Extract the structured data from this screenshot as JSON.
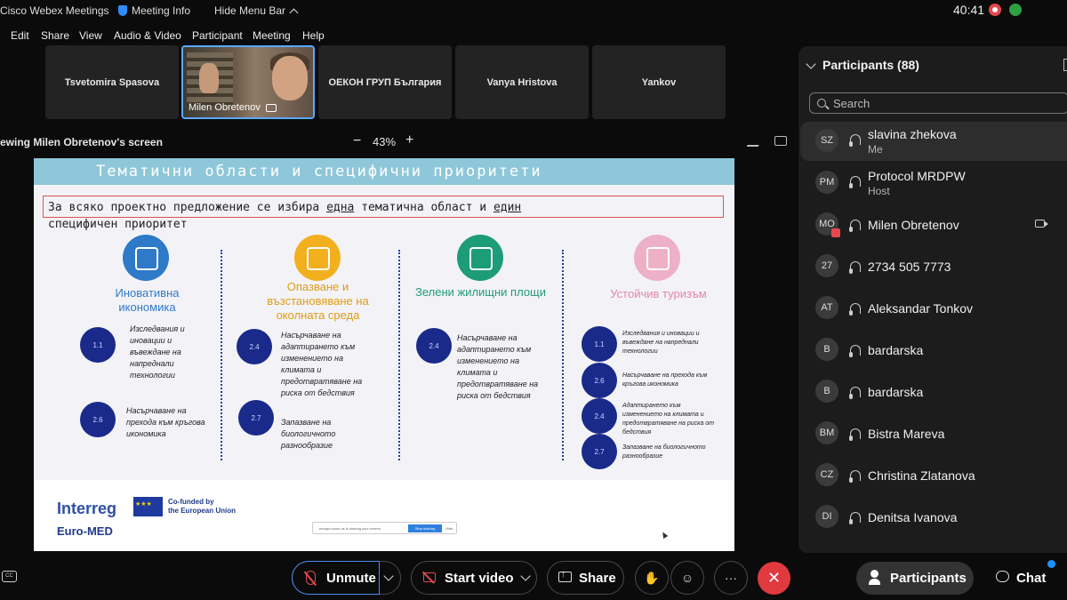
{
  "titlebar": {
    "app_name": "Cisco Webex Meetings",
    "meeting_info": "Meeting Info",
    "hide_menu": "Hide Menu Bar",
    "clock": "40:41"
  },
  "menu": [
    "Edit",
    "Share",
    "View",
    "Audio & Video",
    "Participant",
    "Meeting",
    "Help"
  ],
  "thumbnails": [
    {
      "name": "Tsvetomira Spasova"
    },
    {
      "name": "Milen Obretenov",
      "active": true
    },
    {
      "name": "ОЕКОН ГРУП България"
    },
    {
      "name": "Vanya Hristova"
    },
    {
      "name": "Yankov"
    }
  ],
  "viewbar": {
    "label": "ewing Milen Obretenov's screen",
    "minus": "−",
    "zoom": "43%",
    "plus": "+"
  },
  "slide": {
    "title": "Тематични области и специфични приоритети",
    "intro_a": "За всяко проектно предложение се избира ",
    "intro_u1": "една",
    "intro_b": " тематична област и ",
    "intro_u2": "един",
    "intro_c": "специфичен приоритет",
    "columns": [
      {
        "title": "Иновативна икономика",
        "color": "#2f79c9",
        "title_color": "#2f79c9"
      },
      {
        "title": "Опазване и възстановяване на околната среда",
        "color": "#f2b01e",
        "title_color": "#e09c12"
      },
      {
        "title": "Зелени жилищни площи",
        "color": "#1d9c7a",
        "title_color": "#1d9c7a"
      },
      {
        "title": "Устойчив туризъм",
        "color": "#eeb0c6",
        "title_color": "#e485a6"
      }
    ],
    "items": [
      {
        "num": "1.1",
        "text": "Изследвания и иновации и въвеждане на напреднали технологии"
      },
      {
        "num": "2.6",
        "text": "Насърчаване на прехода към кръгова икономика"
      },
      {
        "num": "2.4",
        "text": "Насърчаване на адаптирането към изменението на климата и предотвратяване на риска от бедствия"
      },
      {
        "num": "2.7",
        "text": "Запазване на биологичното разнообразие"
      },
      {
        "num": "2.4",
        "text": "Насърчаване на адаптирането към изменението на климата и предотвратяване на риска от бедствия"
      },
      {
        "num": "1.1",
        "text": "Изследвания и иновации и въвеждане на напреднали технологии"
      },
      {
        "num": "2.6",
        "text": "Насърчаване на прехода към кръгова икономика"
      },
      {
        "num": "2.4",
        "text": "Адаптирането към изменението на климата и предотвратяване на риска от бедствия"
      },
      {
        "num": "2.7",
        "text": "Запазване на биологичното разнообразие"
      }
    ],
    "footer": {
      "interreg": "Interreg",
      "euro_med": "Euro-MED",
      "cofund_1": "Co-funded by",
      "cofund_2": "the European Union",
      "share_text": "europa.zoom.us is sharing your screen.",
      "share_btn": "Stop sharing",
      "share_hide": "Hide"
    }
  },
  "participants": {
    "header": "Participants (88)",
    "search_placeholder": "Search",
    "list": [
      {
        "initials": "SZ",
        "name": "slavina zhekova",
        "role": "Me"
      },
      {
        "initials": "PM",
        "name": "Protocol MRDPW",
        "role": "Host"
      },
      {
        "initials": "MO",
        "name": "Milen Obretenov",
        "role": ""
      },
      {
        "initials": "27",
        "name": "2734 505 7773",
        "role": ""
      },
      {
        "initials": "AT",
        "name": "Aleksandar Tonkov",
        "role": ""
      },
      {
        "initials": "B",
        "name": "bardarska",
        "role": ""
      },
      {
        "initials": "B",
        "name": "bardarska",
        "role": ""
      },
      {
        "initials": "BM",
        "name": "Bistra Mareva",
        "role": ""
      },
      {
        "initials": "CZ",
        "name": "Christina Zlatanova",
        "role": ""
      },
      {
        "initials": "DI",
        "name": "Denitsa Ivanova",
        "role": ""
      }
    ]
  },
  "controls": {
    "cc": "CC",
    "unmute": "Unmute",
    "start_video": "Start video",
    "share": "Share",
    "hand": "✋",
    "reaction": "☺",
    "more": "···",
    "end": "✕",
    "participants": "Participants",
    "chat": "Chat"
  }
}
